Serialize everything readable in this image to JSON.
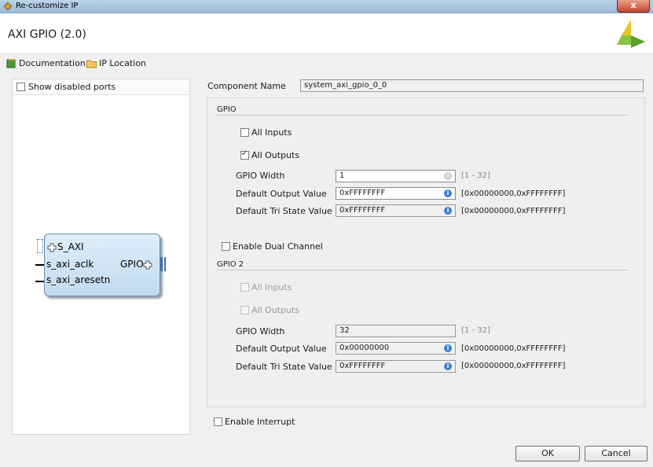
{
  "window": {
    "title": "Re-customize IP",
    "close_label": "x"
  },
  "header": {
    "title": "AXI GPIO (2.0)"
  },
  "links": {
    "documentation": "Documentation",
    "ip_location": "IP Location"
  },
  "left_panel": {
    "show_disabled_ports": "Show disabled ports"
  },
  "ip_symbol": {
    "s_axi": "S_AXI",
    "s_axi_aclk": "s_axi_aclk",
    "s_axi_aresetn": "s_axi_aresetn",
    "gpio": "GPIO"
  },
  "component": {
    "label": "Component Name",
    "value": "system_axi_gpio_0_0"
  },
  "gpio": {
    "title": "GPIO",
    "all_inputs": "All Inputs",
    "all_inputs_checked": false,
    "all_outputs": "All Outputs",
    "all_outputs_checked": true,
    "width_label": "GPIO Width",
    "width_value": "1",
    "width_range": "[1 - 32]",
    "default_output_label": "Default Output Value",
    "default_output_value": "0xFFFFFFFF",
    "default_output_range": "[0x00000000,0xFFFFFFFF]",
    "default_tri_label": "Default Tri State Value",
    "default_tri_value": "0xFFFFFFFF",
    "default_tri_range": "[0x00000000,0xFFFFFFFF]"
  },
  "enable_dual_channel": "Enable Dual Channel",
  "gpio2": {
    "title": "GPIO 2",
    "all_inputs": "All Inputs",
    "all_outputs": "All Outputs",
    "width_label": "GPIO Width",
    "width_value": "32",
    "width_range": "[1 - 32]",
    "default_output_label": "Default Output Value",
    "default_output_value": "0x00000000",
    "default_output_range": "[0x00000000,0xFFFFFFFF]",
    "default_tri_label": "Default Tri State Value",
    "default_tri_value": "0xFFFFFFFF",
    "default_tri_range": "[0x00000000,0xFFFFFFFF]"
  },
  "enable_interrupt": "Enable Interrupt",
  "buttons": {
    "ok": "OK",
    "cancel": "Cancel"
  },
  "colors": {
    "accent_blue": "#3b7fd4",
    "logo_green": "#8bc53f",
    "logo_yellow": "#e6c229"
  }
}
